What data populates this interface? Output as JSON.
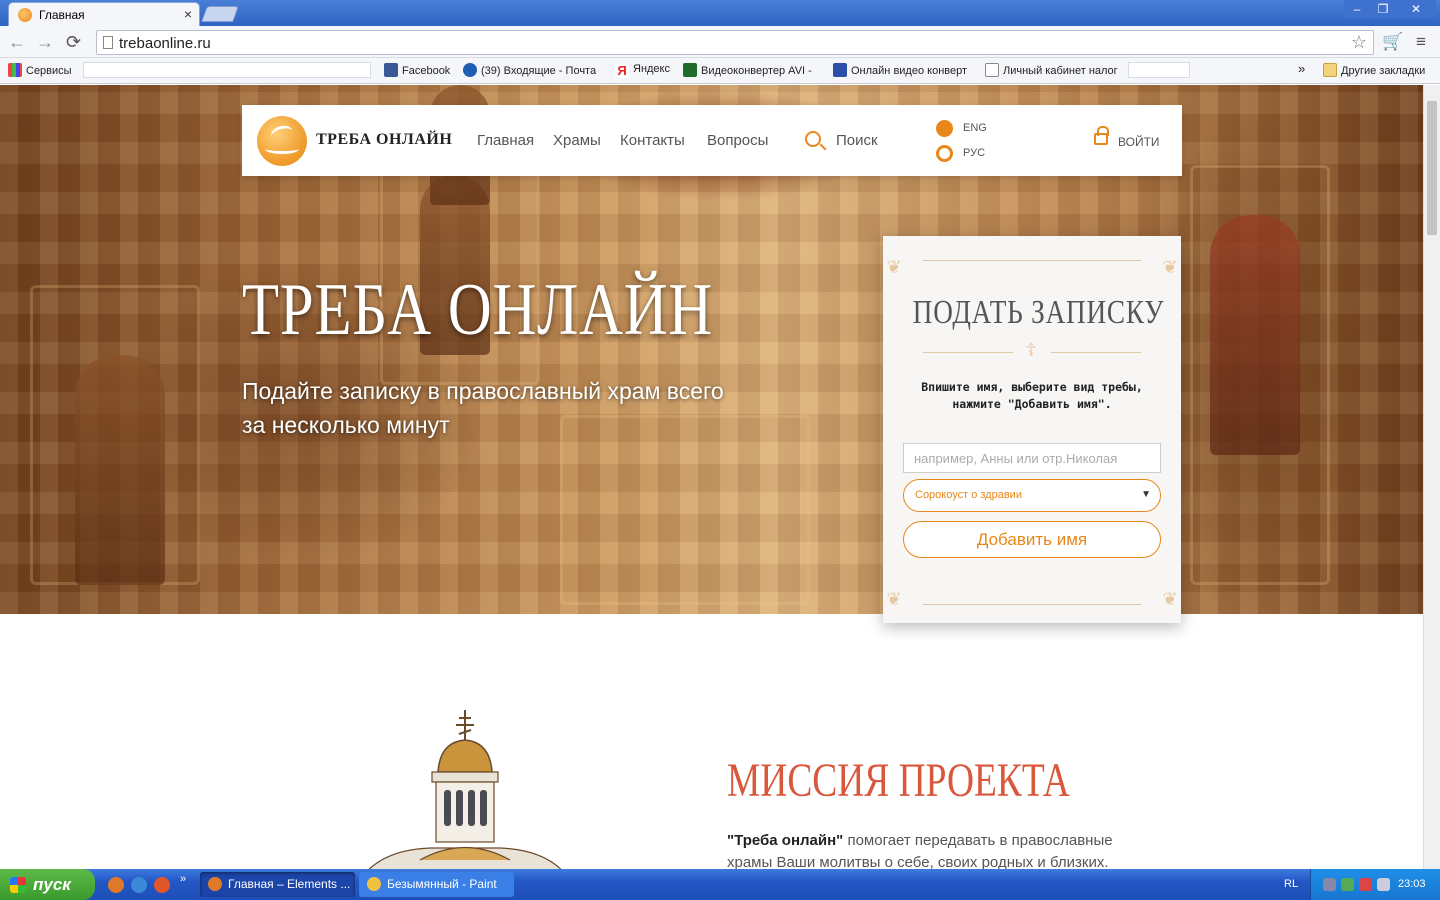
{
  "browser": {
    "tab_title": "Главная",
    "tab_close": "×",
    "url": "trebaonline.ru",
    "window_controls": {
      "minimize": "–",
      "maximize": "❐",
      "close": "✕"
    },
    "nav": {
      "back": "←",
      "forward": "→",
      "reload": "⟳",
      "star": "☆",
      "cart": "🛒",
      "menu": "≡"
    }
  },
  "bookmarks": {
    "items": [
      {
        "label": "Сервисы",
        "icon": "apps-icon"
      },
      {
        "label": "Facebook",
        "icon": "facebook-icon"
      },
      {
        "label": "(39) Входящие - Почта",
        "icon": "mail-icon"
      },
      {
        "label": "Яндекс",
        "icon": "yandex-icon"
      },
      {
        "label": "Видеоконвертер AVI - ",
        "icon": "video-icon"
      },
      {
        "label": "Онлайн видео конверт",
        "icon": "video-icon"
      },
      {
        "label": "Личный кабинет налог",
        "icon": "page-icon"
      }
    ],
    "overflow": "»",
    "other": "Другие закладки"
  },
  "site": {
    "logo_text": "ТРЕБА ОНЛАЙН",
    "nav": [
      "Главная",
      "Храмы",
      "Контакты",
      "Вопросы"
    ],
    "search_label": "Поиск",
    "lang": {
      "eng": "ENG",
      "rus": "РУС"
    },
    "login": "ВОЙТИ"
  },
  "hero": {
    "title": "ТРЕБА ОНЛАЙН",
    "subtitle": "Подайте записку в православный храм всего за несколько минут"
  },
  "note_form": {
    "title": "ПОДАТЬ ЗАПИСКУ",
    "instruction": "Впишите имя, выберите вид требы, нажмите \"Добавить имя\".",
    "name_placeholder": "например, Анны или отр.Николая",
    "type_selected": "Сорокоуст о здравии",
    "add_button": "Добавить имя"
  },
  "mission": {
    "title": "МИССИЯ ПРОЕКТА",
    "brand": "\"Треба онлайн\"",
    "text": " помогает передавать в православные храмы Ваши молитвы о себе, своих родных и близких."
  },
  "taskbar": {
    "start": "пуск",
    "items": [
      "Главная – Elements ...",
      "Безымянный - Paint"
    ],
    "lang": "RL",
    "clock": "23:03"
  }
}
